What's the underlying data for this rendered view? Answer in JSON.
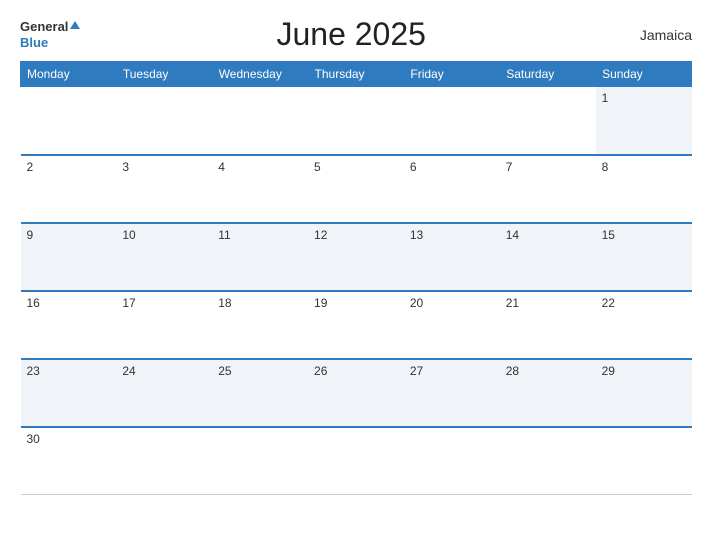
{
  "header": {
    "logo_general": "General",
    "logo_blue": "Blue",
    "title": "June 2025",
    "country": "Jamaica"
  },
  "calendar": {
    "weekdays": [
      "Monday",
      "Tuesday",
      "Wednesday",
      "Thursday",
      "Friday",
      "Saturday",
      "Sunday"
    ],
    "weeks": [
      [
        null,
        null,
        null,
        null,
        null,
        null,
        1
      ],
      [
        2,
        3,
        4,
        5,
        6,
        7,
        8
      ],
      [
        9,
        10,
        11,
        12,
        13,
        14,
        15
      ],
      [
        16,
        17,
        18,
        19,
        20,
        21,
        22
      ],
      [
        23,
        24,
        25,
        26,
        27,
        28,
        29
      ],
      [
        30,
        null,
        null,
        null,
        null,
        null,
        null
      ]
    ]
  }
}
